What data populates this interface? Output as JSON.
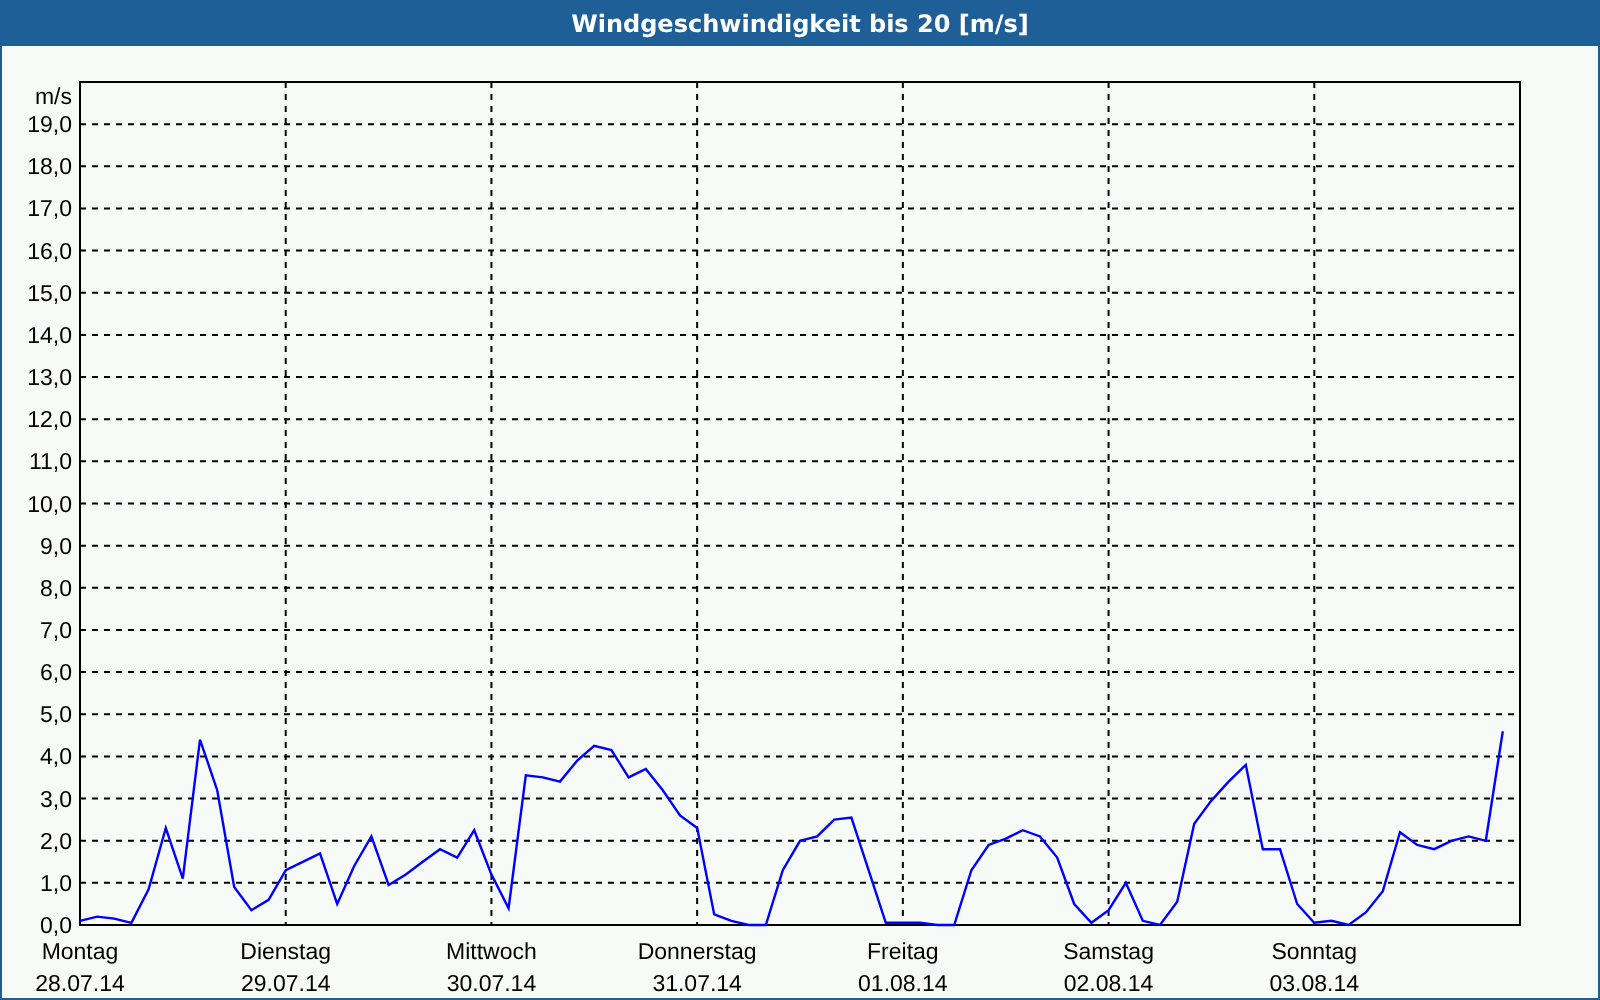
{
  "window": {
    "title": "Windgeschwindigkeit bis 20 [m/s]"
  },
  "chart": {
    "chart_data": {
      "type": "line",
      "grid": true,
      "ylabel": "m/s",
      "ylim": [
        0,
        20
      ],
      "yticks": [
        {
          "value": 0,
          "label": "0,0"
        },
        {
          "value": 1,
          "label": "1,0"
        },
        {
          "value": 2,
          "label": "2,0"
        },
        {
          "value": 3,
          "label": "3,0"
        },
        {
          "value": 4,
          "label": "4,0"
        },
        {
          "value": 5,
          "label": "5,0"
        },
        {
          "value": 6,
          "label": "6,0"
        },
        {
          "value": 7,
          "label": "7,0"
        },
        {
          "value": 8,
          "label": "8,0"
        },
        {
          "value": 9,
          "label": "9,0"
        },
        {
          "value": 10,
          "label": "10,0"
        },
        {
          "value": 11,
          "label": "11,0"
        },
        {
          "value": 12,
          "label": "12,0"
        },
        {
          "value": 13,
          "label": "13,0"
        },
        {
          "value": 14,
          "label": "14,0"
        },
        {
          "value": 15,
          "label": "15,0"
        },
        {
          "value": 16,
          "label": "16,0"
        },
        {
          "value": 17,
          "label": "17,0"
        },
        {
          "value": 18,
          "label": "18,0"
        },
        {
          "value": 19,
          "label": "19,0"
        }
      ],
      "categories": [
        "Montag",
        null,
        null,
        null,
        null,
        null,
        null,
        null,
        null,
        null,
        null,
        null,
        "Dienstag",
        null,
        null,
        null,
        null,
        null,
        null,
        null,
        null,
        null,
        null,
        null,
        "Mittwoch",
        null,
        null,
        null,
        null,
        null,
        null,
        null,
        null,
        null,
        null,
        null,
        "Donnerstag",
        null,
        null,
        null,
        null,
        null,
        null,
        null,
        null,
        null,
        null,
        null,
        "Freitag",
        null,
        null,
        null,
        null,
        null,
        null,
        null,
        null,
        null,
        null,
        null,
        "Samstag",
        null,
        null,
        null,
        null,
        null,
        null,
        null,
        null,
        null,
        null,
        null,
        "Sonntag",
        null,
        null,
        null,
        null,
        null,
        null,
        null,
        null,
        null,
        null,
        null
      ],
      "series": [
        {
          "color": "#0000ff",
          "values": [
            0.1,
            0.2,
            0.15,
            0.05,
            0.85,
            2.3,
            1.1,
            4.4,
            3.2,
            0.9,
            0.35,
            0.6,
            1.3,
            1.5,
            1.7,
            0.5,
            1.4,
            2.1,
            0.95,
            1.2,
            1.5,
            1.8,
            1.6,
            2.25,
            1.2,
            0.4,
            3.55,
            3.5,
            3.4,
            3.9,
            4.25,
            4.15,
            3.5,
            3.7,
            3.2,
            2.6,
            2.3,
            0.25,
            0.1,
            0,
            0,
            1.3,
            2.0,
            2.1,
            2.5,
            2.55,
            1.3,
            0.05,
            0.05,
            0.05,
            0,
            0,
            1.3,
            1.9,
            2.05,
            2.25,
            2.1,
            1.6,
            0.5,
            0.05,
            0.35,
            1.0,
            0.1,
            0,
            0.55,
            2.4,
            2.95,
            3.4,
            3.8,
            1.8,
            1.8,
            0.5,
            0.05,
            0.1,
            0,
            0.3,
            0.8,
            2.2,
            1.9,
            1.8,
            2.0,
            2.1,
            2.0,
            4.6
          ]
        }
      ]
    },
    "date_labels": [
      "28.07.14",
      "29.07.14",
      "30.07.14",
      "31.07.14",
      "01.08.14",
      "02.08.14",
      "03.08.14"
    ]
  }
}
